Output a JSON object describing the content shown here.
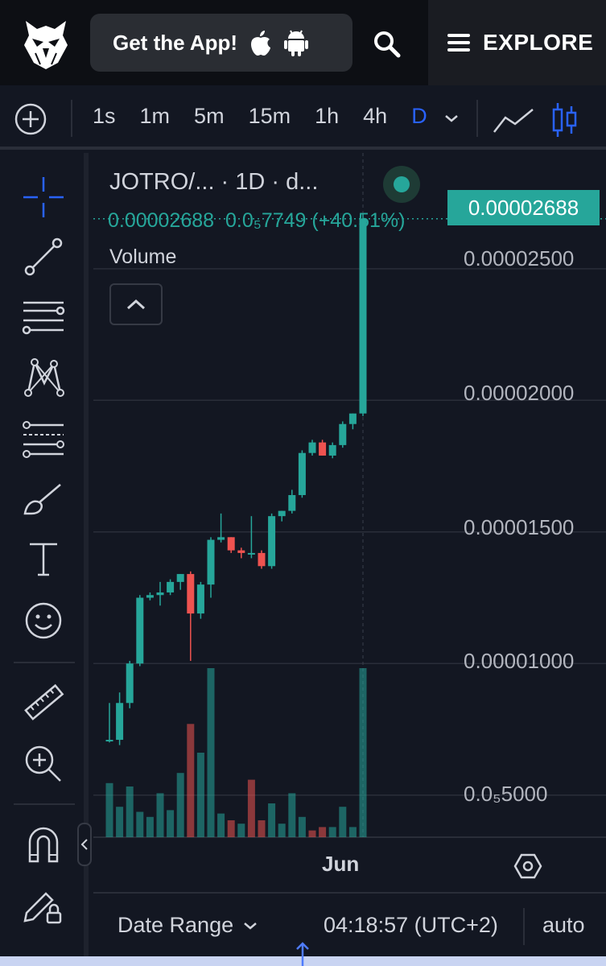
{
  "header": {
    "get_app_label": "Get the App!",
    "explore_label": "EXPLORE",
    "icons": [
      "owl-logo-icon",
      "apple-icon",
      "android-icon",
      "search-icon",
      "menu-icon"
    ]
  },
  "toolbar": {
    "intervals": [
      "1s",
      "1m",
      "5m",
      "15m",
      "1h",
      "4h",
      "D"
    ],
    "active_interval": "D",
    "icons": [
      "add-icon",
      "chevron-down-icon",
      "line-chart-icon",
      "candlestick-icon"
    ]
  },
  "sidebar": {
    "tools": [
      "crosshair-icon",
      "trend-line-icon",
      "horizontal-lines-icon",
      "pattern-icon",
      "fib-icon",
      "brush-icon",
      "text-icon",
      "emoji-icon",
      "ruler-icon",
      "zoom-in-icon",
      "magnet-icon",
      "lock-pencil-icon"
    ]
  },
  "chart": {
    "legend_title": "JOTRO/... · 1D · d...",
    "legend_price": "0.00002688",
    "legend_change": "0.0₅7749 (+40.51%)",
    "volume_label": "Volume",
    "current_price_tag": "0.00002688",
    "price_axis_labels": [
      "0.00002500",
      "0.00002000",
      "0.00001500",
      "0.00001000",
      "0.0₅5000"
    ],
    "time_label": "Jun",
    "colors": {
      "up": "#26a69a",
      "down": "#ef5350",
      "accent": "#2962ff"
    }
  },
  "chart_data": {
    "type": "candlestick",
    "ylim": [
      3.4e-06,
      2.94e-05
    ],
    "y_ticks": [
      2.5e-05,
      2e-05,
      1.5e-05,
      1e-05,
      5e-06
    ],
    "x_tick": "Jun",
    "series": [
      {
        "name": "Price",
        "candles": [
          [
            7.1e-06,
            8.5e-06,
            7e-06,
            7.1e-06
          ],
          [
            7.1e-06,
            8.9e-06,
            6.9e-06,
            8.5e-06
          ],
          [
            8.5e-06,
            1.01e-05,
            8.3e-06,
            1e-05
          ],
          [
            1e-05,
            1.26e-05,
            9.9e-06,
            1.25e-05
          ],
          [
            1.25e-05,
            1.27e-05,
            1.24e-05,
            1.26e-05
          ],
          [
            1.26e-05,
            1.31e-05,
            1.22e-05,
            1.27e-05
          ],
          [
            1.27e-05,
            1.32e-05,
            1.26e-05,
            1.31e-05
          ],
          [
            1.31e-05,
            1.34e-05,
            1.28e-05,
            1.34e-05
          ],
          [
            1.34e-05,
            1.35e-05,
            1.01e-05,
            1.19e-05
          ],
          [
            1.19e-05,
            1.31e-05,
            1.17e-05,
            1.3e-05
          ],
          [
            1.3e-05,
            1.48e-05,
            1.25e-05,
            1.47e-05
          ],
          [
            1.47e-05,
            1.57e-05,
            1.46e-05,
            1.48e-05
          ],
          [
            1.48e-05,
            1.48e-05,
            1.42e-05,
            1.43e-05
          ],
          [
            1.43e-05,
            1.44e-05,
            1.4e-05,
            1.42e-05
          ],
          [
            1.42e-05,
            1.56e-05,
            1.4e-05,
            1.42e-05
          ],
          [
            1.42e-05,
            1.43e-05,
            1.36e-05,
            1.37e-05
          ],
          [
            1.37e-05,
            1.57e-05,
            1.36e-05,
            1.56e-05
          ],
          [
            1.56e-05,
            1.58e-05,
            1.54e-05,
            1.58e-05
          ],
          [
            1.58e-05,
            1.66e-05,
            1.57e-05,
            1.64e-05
          ],
          [
            1.64e-05,
            1.81e-05,
            1.63e-05,
            1.8e-05
          ],
          [
            1.8e-05,
            1.85e-05,
            1.79e-05,
            1.84e-05
          ],
          [
            1.84e-05,
            1.85e-05,
            1.79e-05,
            1.79e-05
          ],
          [
            1.79e-05,
            1.84e-05,
            1.78e-05,
            1.83e-05
          ],
          [
            1.83e-05,
            1.92e-05,
            1.82e-05,
            1.91e-05
          ],
          [
            1.91e-05,
            1.95e-05,
            1.89e-05,
            1.95e-05
          ],
          [
            1.95e-05,
            2.71e-05,
            1.94e-05,
            2.69e-05
          ]
        ]
      },
      {
        "name": "Volume",
        "values": [
          [
            32,
            "up"
          ],
          [
            18,
            "up"
          ],
          [
            30,
            "up"
          ],
          [
            15,
            "up"
          ],
          [
            12,
            "up"
          ],
          [
            26,
            "up"
          ],
          [
            16,
            "up"
          ],
          [
            38,
            "up"
          ],
          [
            67,
            "down"
          ],
          [
            50,
            "up"
          ],
          [
            100,
            "up"
          ],
          [
            14,
            "up"
          ],
          [
            10,
            "down"
          ],
          [
            8,
            "up"
          ],
          [
            34,
            "down"
          ],
          [
            10,
            "down"
          ],
          [
            20,
            "up"
          ],
          [
            8,
            "up"
          ],
          [
            26,
            "up"
          ],
          [
            12,
            "up"
          ],
          [
            4,
            "down"
          ],
          [
            6,
            "down"
          ],
          [
            6,
            "up"
          ],
          [
            18,
            "up"
          ],
          [
            6,
            "up"
          ],
          [
            100,
            "up"
          ]
        ]
      }
    ]
  },
  "bottom": {
    "date_range_label": "Date Range",
    "clock": "04:18:57 (UTC+2)",
    "auto_label": "auto"
  }
}
